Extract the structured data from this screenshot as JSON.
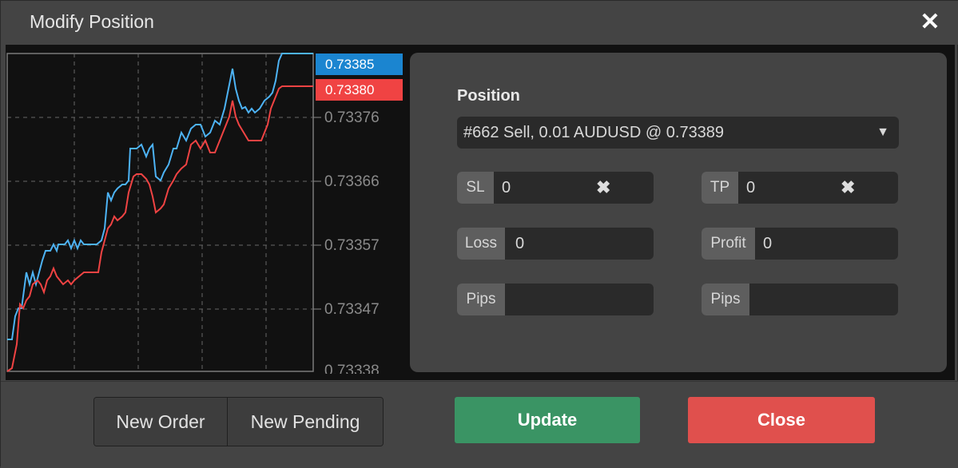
{
  "window": {
    "title": "Modify Position"
  },
  "chart": {
    "ask_price": "0.73385",
    "bid_price": "0.73380",
    "ask_color": "#1b85d0",
    "bid_color": "#f04343",
    "tick_labels": [
      "0.73376",
      "0.73366",
      "0.73357",
      "0.73347",
      "0.73338"
    ]
  },
  "form": {
    "position_label": "Position",
    "position_selected": "#662 Sell, 0.01 AUDUSD @ 0.73389",
    "sl": {
      "prefix": "SL",
      "value": "0"
    },
    "tp": {
      "prefix": "TP",
      "value": "0"
    },
    "loss": {
      "prefix": "Loss",
      "value": "0"
    },
    "profit": {
      "prefix": "Profit",
      "value": "0"
    },
    "pips_left": {
      "prefix": "Pips",
      "value": ""
    },
    "pips_right": {
      "prefix": "Pips",
      "value": ""
    }
  },
  "footer": {
    "new_order": "New Order",
    "new_pending": "New Pending",
    "update": "Update",
    "close": "Close"
  },
  "colors": {
    "update_green": "#3a9464",
    "close_red": "#e0504d"
  }
}
